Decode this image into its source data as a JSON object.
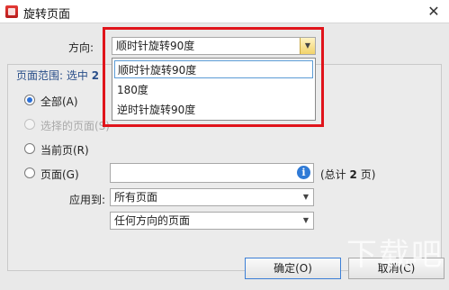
{
  "window": {
    "title": "旋转页面",
    "close_glyph": "✕"
  },
  "direction": {
    "label": "方向:",
    "selected": "顺时针旋转90度"
  },
  "dropdown_options": [
    "顺时针旋转90度",
    "180度",
    "逆时针旋转90度"
  ],
  "page_range": {
    "legend_prefix": "页面范围: 选中",
    "legend_count": "2",
    "all_label": "全部(A)",
    "selected_pages_label": "选择的页面(S)",
    "current_page_label": "当前页(R)",
    "pages_label": "页面(G)",
    "pages_value": "",
    "total_prefix": "(总计",
    "total_count": "2",
    "total_suffix": "页)",
    "apply_to_label": "应用到:",
    "apply_to_value": "所有页面",
    "orientation_value": "任何方向的页面"
  },
  "buttons": {
    "ok": "确定(O)",
    "cancel": "取消(C)"
  },
  "watermark": "下载吧",
  "colors": {
    "highlight": "#e0141b",
    "accent": "#2f7ad6"
  }
}
